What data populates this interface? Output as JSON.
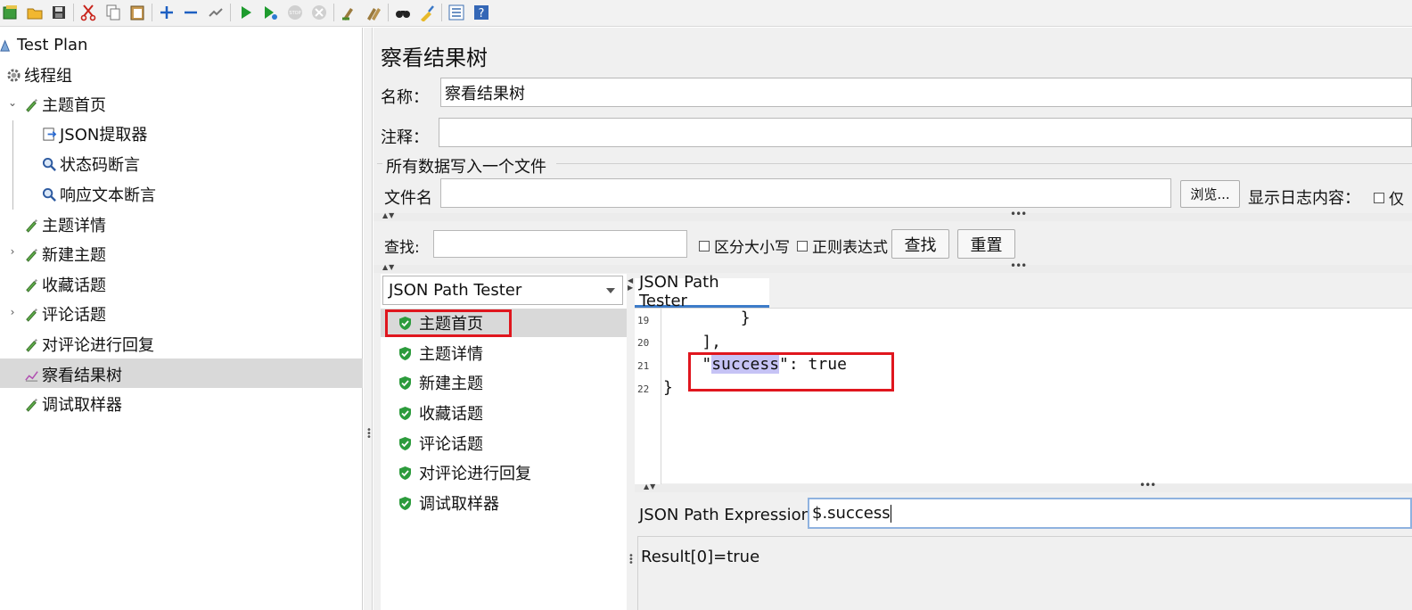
{
  "toolbar": {
    "icons": [
      "templates-icon",
      "open-icon",
      "save-icon",
      "cut-icon",
      "copy-icon",
      "paste-icon",
      "expand-icon",
      "collapse-icon",
      "toggle-icon",
      "start-icon",
      "start-no-pause-icon",
      "stop-icon",
      "shutdown-icon",
      "clear-icon",
      "clear-all-icon",
      "search-icon",
      "reset-search-icon",
      "function-helper-icon",
      "help-icon"
    ]
  },
  "tree": {
    "items": [
      {
        "label": "Test Plan",
        "icon": "test-plan-icon"
      },
      {
        "label": "线程组",
        "icon": "gear-icon"
      },
      {
        "label": "主题首页",
        "icon": "sampler-icon"
      },
      {
        "label": "JSON提取器",
        "icon": "extractor-icon"
      },
      {
        "label": "状态码断言",
        "icon": "assertion-icon"
      },
      {
        "label": "响应文本断言",
        "icon": "assertion-icon"
      },
      {
        "label": "主题详情",
        "icon": "sampler-icon"
      },
      {
        "label": "新建主题",
        "icon": "sampler-icon"
      },
      {
        "label": "收藏话题",
        "icon": "sampler-icon"
      },
      {
        "label": "评论话题",
        "icon": "sampler-icon"
      },
      {
        "label": "对评论进行回复",
        "icon": "sampler-icon"
      },
      {
        "label": "察看结果树",
        "icon": "listener-icon"
      },
      {
        "label": "调试取样器",
        "icon": "sampler-icon"
      }
    ]
  },
  "panel": {
    "title": "察看结果树",
    "name_label": "名称：",
    "name_value": "察看结果树",
    "comment_label": "注释：",
    "comment_value": "",
    "file_group_title": "所有数据写入一个文件",
    "filename_label": "文件名",
    "filename_value": "",
    "browse_button": "浏览...",
    "log_label": "显示日志内容：",
    "log_checkbox_fragment": "仅"
  },
  "search": {
    "label": "查找:",
    "value": "",
    "case_label": "区分大小写",
    "regex_label": "正则表达式",
    "find_button": "查找",
    "reset_button": "重置"
  },
  "results": {
    "renderer": "JSON Path Tester",
    "items": [
      "主题首页",
      "主题详情",
      "新建主题",
      "收藏话题",
      "评论话题",
      "对评论进行回复",
      "调试取样器"
    ]
  },
  "tester": {
    "tab_label": "JSON Path Tester",
    "lines": [
      {
        "n": "19",
        "text": "        }"
      },
      {
        "n": "20",
        "text": "    ],"
      },
      {
        "n": "21",
        "pre": "    \"",
        "hl": "success",
        "post": "\": true"
      },
      {
        "n": "22",
        "text": "}"
      }
    ],
    "expression_label": "JSON Path Expression",
    "expression_value": "$.success",
    "result": "Result[0]=true"
  },
  "colors": {
    "highlight_box": "#e0161e",
    "search_match": "#c6c3f5",
    "tab_accent": "#3d7cc9"
  }
}
